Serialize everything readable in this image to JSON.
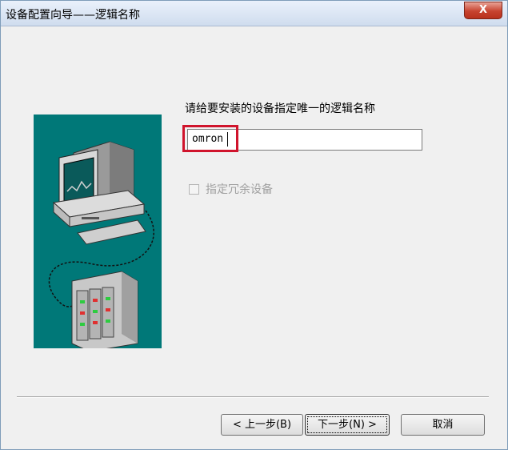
{
  "window": {
    "title": "设备配置向导——逻辑名称",
    "close_label": "X"
  },
  "main": {
    "prompt": "请给要安装的设备指定唯一的逻辑名称",
    "name_value": "omron",
    "redundant_checkbox": {
      "label": "指定冗余设备",
      "checked": false,
      "enabled": false
    }
  },
  "illustration": {
    "icon": "computer-connected-to-plc-icon"
  },
  "footer": {
    "back_label": "< 上一步(B)",
    "next_label": "下一步(N) >",
    "cancel_label": "取消"
  },
  "colors": {
    "illustration_bg": "#007878",
    "highlight": "#d0142c",
    "close_button": "#c7432f"
  }
}
